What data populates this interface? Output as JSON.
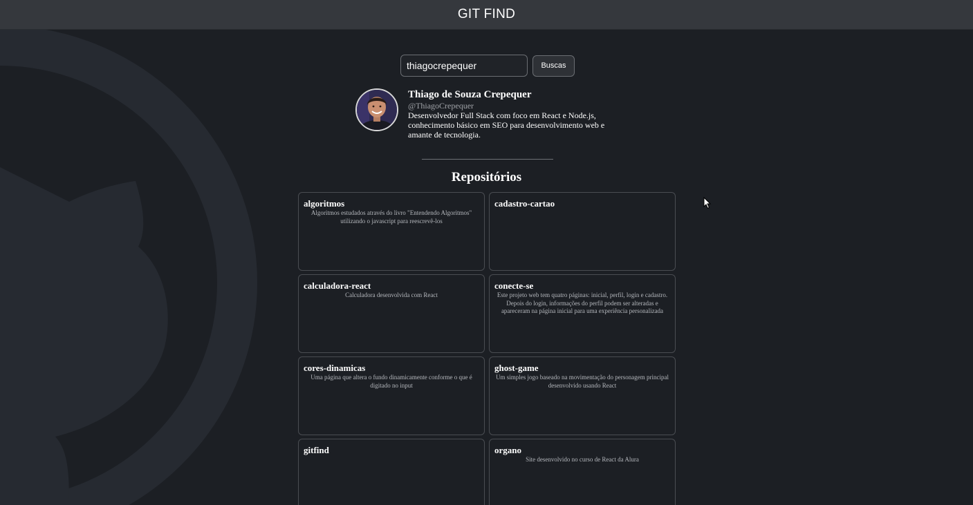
{
  "header": {
    "title": "GIT FIND"
  },
  "search": {
    "value": "thiagocrepequer",
    "button_label": "Buscas"
  },
  "profile": {
    "name": "Thiago de Souza Crepequer",
    "login": "@ThiagoCrepequer",
    "bio": "Desenvolvedor Full Stack com foco em React e Node.js, conhecimento básico em SEO para desenvolvimento web e amante de tecnologia."
  },
  "repositories": {
    "title": "Repositórios",
    "items": [
      {
        "name": "algoritmos",
        "description": "Algoritmos estudados através do livro \"Entendendo Algoritmos\" utilizando o javascript para reescrevê-los"
      },
      {
        "name": "cadastro-cartao",
        "description": ""
      },
      {
        "name": "calculadora-react",
        "description": "Calculadora desenvolvida com React"
      },
      {
        "name": "conecte-se",
        "description": "Este projeto web tem quatro páginas: inicial, perfil, login e cadastro. Depois do login, informações do perfil podem ser alteradas e apareceram na página inicial para uma experiência personalizada"
      },
      {
        "name": "cores-dinamicas",
        "description": "Uma página que altera o fundo dinamicamente conforme o que é digitado no input"
      },
      {
        "name": "ghost-game",
        "description": "Um simples jogo baseado na movimentação do personagem principal desenvolvido usando React"
      },
      {
        "name": "gitfind",
        "description": ""
      },
      {
        "name": "organo",
        "description": "Site desenvolvido no curso de React da Alura"
      }
    ]
  },
  "colors": {
    "background": "#1c1f24",
    "header": "#35383d",
    "card_border": "#4a4d52",
    "muted_text": "#a0a3a8"
  },
  "icons": {
    "background": "github-octocat-icon",
    "avatar": "user-avatar-photo",
    "pointer": "mouse-cursor-icon"
  }
}
